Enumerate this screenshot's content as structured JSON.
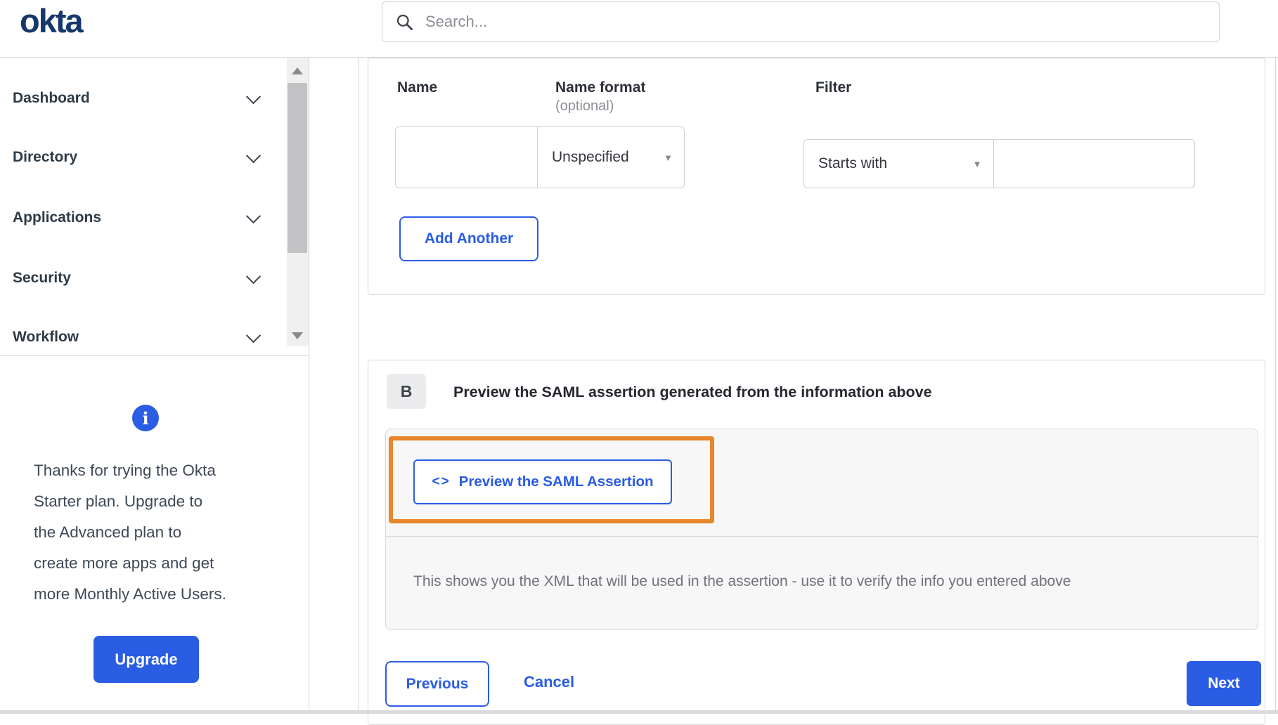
{
  "header": {
    "logo": "okta",
    "search_placeholder": "Search..."
  },
  "sidebar": {
    "items": [
      {
        "label": "Dashboard"
      },
      {
        "label": "Directory"
      },
      {
        "label": "Applications"
      },
      {
        "label": "Security"
      },
      {
        "label": "Workflow"
      }
    ]
  },
  "upgrade_panel": {
    "message_lines": [
      "Thanks for trying the Okta",
      "Starter plan. Upgrade to",
      "the Advanced plan to",
      "create more apps and get",
      "more Monthly Active Users."
    ],
    "info_icon_glyph": "i",
    "button_label": "Upgrade"
  },
  "attribute_form": {
    "name_label": "Name",
    "name_format_label": "Name format",
    "name_format_optional": "(optional)",
    "filter_label": "Filter",
    "name_value": "",
    "name_format_selected": "Unspecified",
    "filter_operator_selected": "Starts with",
    "filter_value": "",
    "dropdown_caret": "▼",
    "add_another_label": "Add Another"
  },
  "section_b": {
    "badge": "B",
    "title": "Preview the SAML assertion generated from the information above",
    "preview_button": {
      "icon": "<>",
      "label": "Preview the SAML Assertion"
    },
    "description": "This shows you the XML that will be used in the assertion - use it to verify the info you entered above"
  },
  "footer": {
    "previous_label": "Previous",
    "cancel_label": "Cancel",
    "next_label": "Next"
  },
  "colors": {
    "accent_blue": "#2a5ce4",
    "logo_navy": "#16386b",
    "highlight_orange": "#e8862c"
  }
}
